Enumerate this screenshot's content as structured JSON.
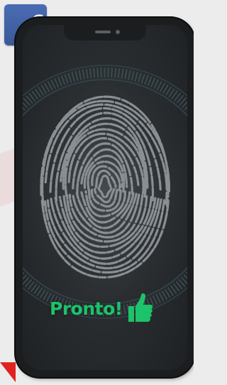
{
  "brand": {
    "name": "facebook",
    "glyph": "f",
    "color": "#3b5998"
  },
  "status": {
    "text": "Pronto!",
    "color": "#1cc36a",
    "icon": "thumbs-up-icon"
  },
  "colors": {
    "accent_red": "#e02222",
    "phone_body": "#1b1d1f",
    "fingerprint": "#8a8f93"
  }
}
